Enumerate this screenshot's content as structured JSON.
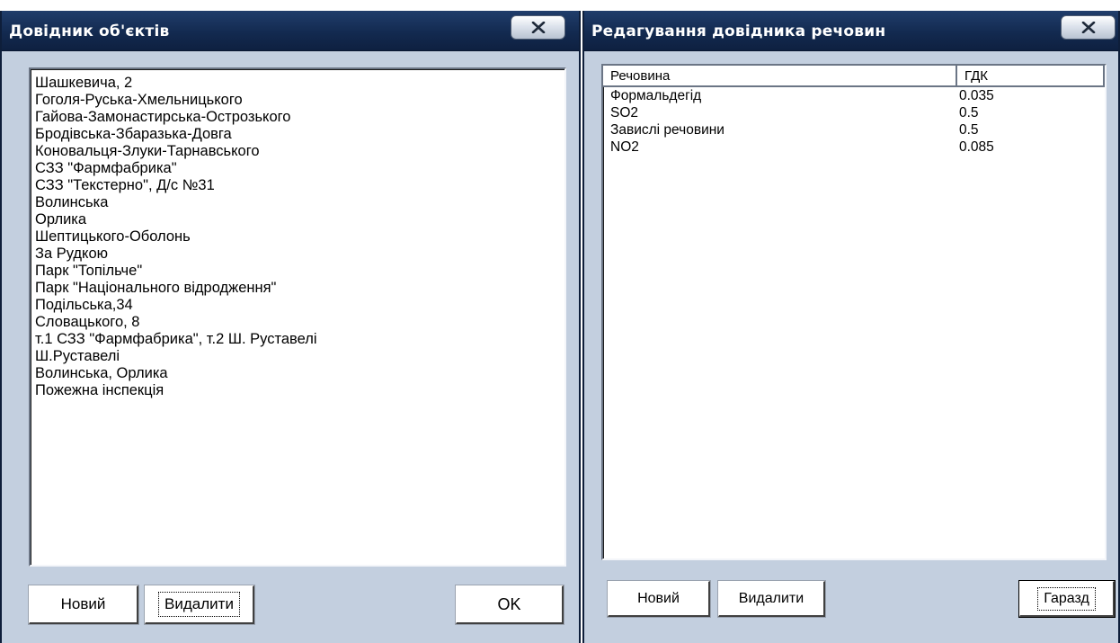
{
  "objects_window": {
    "title": "Довідник об'єктів",
    "items": [
      "Шашкевича, 2",
      "Гоголя-Руська-Хмельницького",
      "Гайова-Замонастирська-Острозького",
      "Бродівська-Збаразька-Довга",
      "Коновальця-Злуки-Тарнавського",
      "СЗЗ \"Фармфабрика\"",
      "СЗЗ \"Текстерно\", Д/с №31",
      "Волинська",
      "Орлика",
      "Шептицького-Оболонь",
      "За Рудкою",
      "Парк \"Топільче\"",
      "Парк \"Національного відродження\"",
      "Подільська,34",
      "Словацького, 8",
      "т.1 СЗЗ \"Фармфабрика\", т.2 Ш. Руставелі",
      "Ш.Руставелі",
      "Волинська, Орлика",
      "Пожежна інспекція"
    ],
    "buttons": {
      "new": "Новий",
      "delete": "Видалити",
      "ok": "OK"
    }
  },
  "substances_window": {
    "title": "Редагування довідника речовин",
    "columns": [
      "Речовина",
      "ГДК"
    ],
    "rows": [
      {
        "name": "Формальдегід",
        "gdk": "0.035"
      },
      {
        "name": "SO2",
        "gdk": "0.5"
      },
      {
        "name": "Завислі речовини",
        "gdk": "0.5"
      },
      {
        "name": "NO2",
        "gdk": "0.085"
      }
    ],
    "buttons": {
      "new": "Новий",
      "delete": "Видалити",
      "ok": "Гаразд"
    }
  },
  "icons": {
    "close": "close-icon"
  },
  "colors": {
    "titlebar": "#132a50",
    "window_bg": "#c3cfdf"
  }
}
